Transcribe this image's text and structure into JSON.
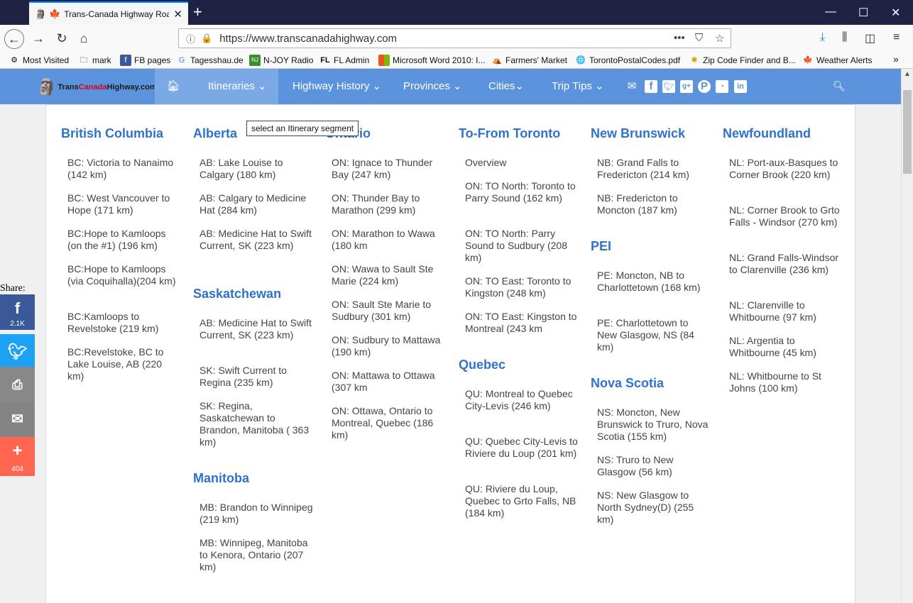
{
  "browser": {
    "tab_title": "Trans-Canada Highway Roa",
    "url_host": "https://www.transcanadahighway.com",
    "bookmarks": [
      {
        "label": "Most Visited",
        "icon": "gear-icon"
      },
      {
        "label": "mark",
        "icon": "folder-icon"
      },
      {
        "label": "FB pages",
        "icon": "facebook-icon"
      },
      {
        "label": "Tagesshau.de",
        "icon": "google-icon"
      },
      {
        "label": "N-JOY Radio",
        "icon": "njoy-icon"
      },
      {
        "label": "FL Admin",
        "icon": "fl-icon"
      },
      {
        "label": "Microsoft Word 2010: I...",
        "icon": "microsoft-icon"
      },
      {
        "label": "Farmers' Market",
        "icon": "farm-icon"
      },
      {
        "label": "TorontoPostalCodes.pdf",
        "icon": "globe-icon"
      },
      {
        "label": "Zip Code Finder and B...",
        "icon": "zip-icon"
      },
      {
        "label": "Weather Alerts",
        "icon": "maple-leaf-icon"
      }
    ]
  },
  "site": {
    "logo": {
      "part1": "Trans",
      "part2": "Canada",
      "part3": "Highway.com"
    },
    "nav": [
      {
        "label": "Itineraries ⌄",
        "active": true
      },
      {
        "label": "Highway History ⌄"
      },
      {
        "label": "Provinces ⌄"
      },
      {
        "label": "Cities⌄"
      },
      {
        "label": "Trip Tips ⌄"
      }
    ],
    "tooltip": "select an Itinerary segment"
  },
  "menu": {
    "bc": {
      "title": "British Columbia",
      "links": [
        "BC: Victoria to Nanaimo (142 km)",
        "BC: West Vancouver to Hope (171 km)",
        "BC:Hope to Kamloops (on the #1) (196 km)",
        "BC:Hope to Kamloops (via Coquihalla)(204 km)",
        "BC:Kamloops to Revelstoke (219 km)",
        "BC:Revelstoke, BC to Lake Louise, AB (220 km)"
      ]
    },
    "ab": {
      "title": "Alberta",
      "links": [
        "AB: Lake Louise to Calgary (180 km)",
        "AB: Calgary to Medicine Hat (284 km)",
        "AB: Medicine Hat to Swift Current, SK (223 km)"
      ]
    },
    "sk": {
      "title": "Saskatchewan",
      "links": [
        "AB: Medicine Hat to Swift Current, SK (223 km)",
        "SK: Swift Current to Regina (235 km)",
        "SK: Regina, Saskatchewan to Brandon, Manitoba ( 363 km)"
      ]
    },
    "mb": {
      "title": "Manitoba",
      "links": [
        "MB: Brandon to Winnipeg (219 km)",
        "MB: Winnipeg, Manitoba to Kenora, Ontario (207 km)"
      ]
    },
    "on": {
      "title": "Ontario",
      "links": [
        "ON: Ignace to Thunder Bay (247 km)",
        "ON: Thunder Bay to Marathon (299 km)",
        "ON: Marathon to Wawa (180 km",
        "ON: Wawa to Sault Ste Marie (224 km)",
        "ON: Sault Ste Marie to Sudbury (301 km)",
        "ON: Sudbury to Mattawa (190 km)",
        "ON: Mattawa to Ottawa (307 km",
        "ON: Ottawa, Ontario to Montreal, Quebec (186 km)"
      ]
    },
    "to": {
      "title": "To-From Toronto",
      "links": [
        "Overview",
        "ON: TO North: Toronto to Parry Sound (162 km)",
        "ON: TO North: Parry Sound to Sudbury (208 km)",
        "ON: TO East: Toronto to Kingston (248 km)",
        "ON: TO East: Kingston to Montreal (243 km"
      ]
    },
    "qc": {
      "title": "Quebec",
      "links": [
        "QU: Montreal to Quebec City-Levis (246 km)",
        "QU: Quebec City-Levis to Riviere du Loup (201 km)",
        "QU: Riviere du Loup, Quebec to Grto Falls, NB (184 km)"
      ]
    },
    "nb": {
      "title": "New Brunswick",
      "links": [
        "NB: Grand Falls to Fredericton (214 km)",
        "NB: Fredericton to Moncton (187 km)"
      ]
    },
    "pei": {
      "title": "PEI",
      "links": [
        "PE: Moncton, NB to Charlottetown (168 km)",
        "PE: Charlottetown to New Glasgow, NS (84 km)"
      ]
    },
    "ns": {
      "title": "Nova Scotia",
      "links": [
        "NS: Moncton, New Brunswick to Truro, Nova Scotia (155 km)",
        "NS: Truro to New Glasgow (56 km)",
        "NS: New Glasgow to North Sydney(D) (255 km)"
      ]
    },
    "nl": {
      "title": "Newfoundland",
      "links": [
        "NL: Port-aux-Basques to Corner Brook (220 km)",
        "NL: Corner Brook to Grto Falls - Windsor (270 km)",
        "NL: Grand Falls-Windsor to Clarenville (236 km)",
        "NL: Clarenville to Whitbourne (97 km)",
        "NL: Argentia to Whitbourne (45 km)",
        "NL: Whitbourne to St Johns (100 km)"
      ]
    }
  },
  "share": {
    "label": "Share:",
    "facebook_count": "2.1K",
    "more_count": "404",
    "colors": {
      "facebook": "#3b5998",
      "twitter": "#1da1f2",
      "print": "#888888",
      "email": "#848484",
      "more": "#ff6550"
    }
  }
}
